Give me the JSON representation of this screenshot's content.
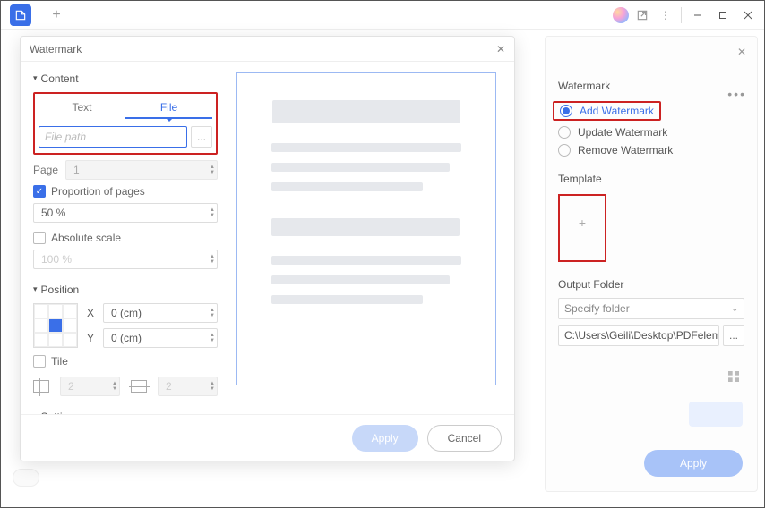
{
  "modal": {
    "title": "Watermark",
    "content_section": "Content",
    "tabs": {
      "text": "Text",
      "file": "File"
    },
    "file_placeholder": "File path",
    "browse": "...",
    "page_label": "Page",
    "page_value": "1",
    "proportion_label": "Proportion of pages",
    "proportion_value": "50 %",
    "absolute_label": "Absolute scale",
    "absolute_value": "100 %",
    "position_section": "Position",
    "x_label": "X",
    "x_value": "0 (cm)",
    "y_label": "Y",
    "y_value": "0 (cm)",
    "tile_label": "Tile",
    "tile_v": "2",
    "tile_h": "2",
    "setting_section": "Setting",
    "apply": "Apply",
    "cancel": "Cancel"
  },
  "side": {
    "title": "Watermark",
    "opts": {
      "add": "Add Watermark",
      "update": "Update Watermark",
      "remove": "Remove Watermark"
    },
    "template": "Template",
    "add_tmpl": "+",
    "output_label": "Output Folder",
    "specify": "Specify folder",
    "path": "C:\\Users\\Geili\\Desktop\\PDFelement\\W...",
    "browse": "...",
    "apply": "Apply"
  },
  "win": {
    "more": "⋮"
  }
}
